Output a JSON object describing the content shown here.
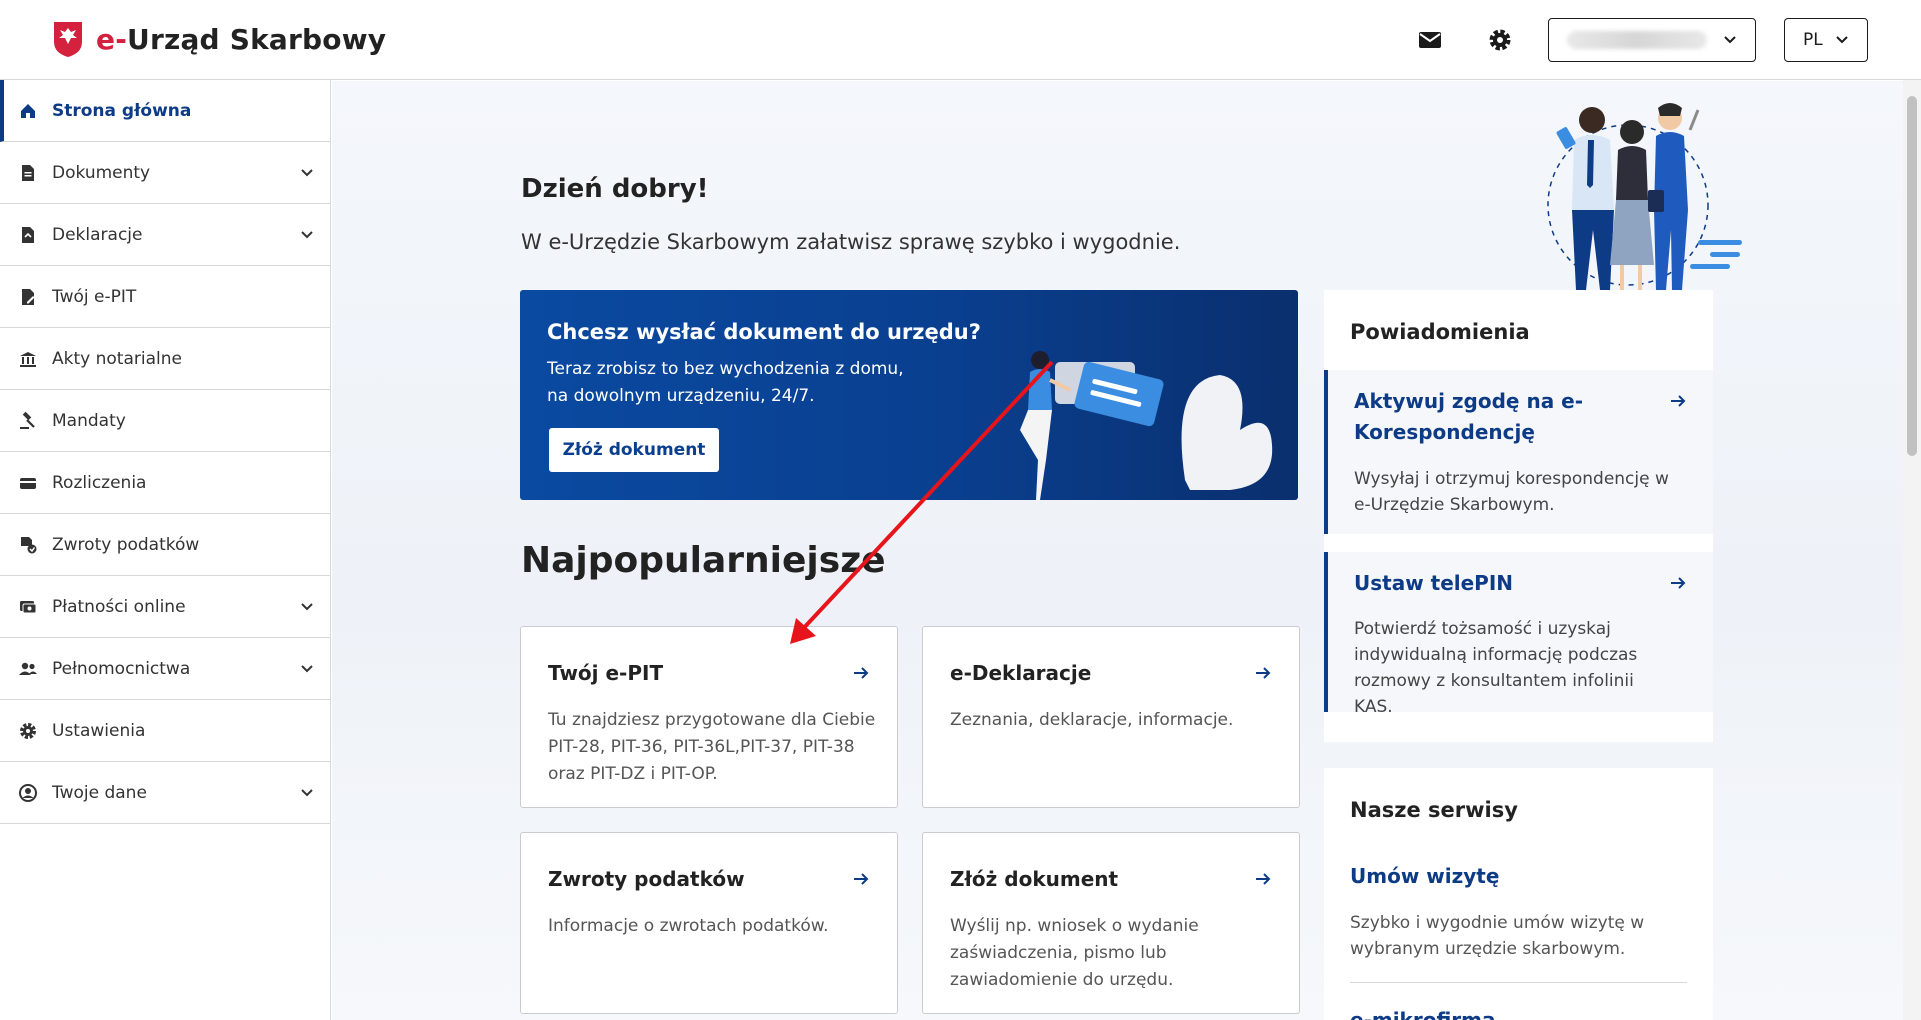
{
  "header": {
    "brand_prefix": "e-",
    "brand_rest": "Urząd Skarbowy",
    "language": "PL"
  },
  "sidebar": {
    "items": [
      {
        "label": "Strona główna",
        "icon": "home-icon",
        "expandable": false,
        "active": true
      },
      {
        "label": "Dokumenty",
        "icon": "document-icon",
        "expandable": true
      },
      {
        "label": "Deklaracje",
        "icon": "declaration-icon",
        "expandable": true
      },
      {
        "label": "Twój e-PIT",
        "icon": "epit-icon",
        "expandable": false
      },
      {
        "label": "Akty notarialne",
        "icon": "notary-icon",
        "expandable": false
      },
      {
        "label": "Mandaty",
        "icon": "gavel-icon",
        "expandable": false
      },
      {
        "label": "Rozliczenia",
        "icon": "wallet-icon",
        "expandable": false
      },
      {
        "label": "Zwroty podatków",
        "icon": "refund-icon",
        "expandable": false
      },
      {
        "label": "Płatności online",
        "icon": "payment-icon",
        "expandable": true
      },
      {
        "label": "Pełnomocnictwa",
        "icon": "people-icon",
        "expandable": true
      },
      {
        "label": "Ustawienia",
        "icon": "gear-icon",
        "expandable": false
      },
      {
        "label": "Twoje dane",
        "icon": "user-circle-icon",
        "expandable": true
      }
    ]
  },
  "greeting": {
    "title": "Dzień dobry!",
    "subtitle": "W e-Urzędzie Skarbowym załatwisz sprawę szybko i wygodnie."
  },
  "banner": {
    "title": "Chcesz wysłać dokument do urzędu?",
    "line1": "Teraz zrobisz to bez wychodzenia z domu,",
    "line2": "na dowolnym urządzeniu, 24/7.",
    "button": "Złóż dokument"
  },
  "popular": {
    "title": "Najpopularniejsze",
    "cards": [
      {
        "title": "Twój e-PIT",
        "desc": "Tu znajdziesz przygotowane dla Ciebie PIT-28, PIT-36, PIT-36L,PIT-37, PIT-38 oraz PIT-DZ i PIT-OP."
      },
      {
        "title": "e-Deklaracje",
        "desc": "Zeznania, deklaracje, informacje."
      },
      {
        "title": "Zwroty podatków",
        "desc": "Informacje o zwrotach podatków."
      },
      {
        "title": "Złóż dokument",
        "desc": "Wyślij np. wniosek o wydanie zaświadczenia, pismo lub zawiadomienie do urzędu."
      }
    ]
  },
  "notifications": {
    "title": "Powiadomienia",
    "items": [
      {
        "title": "Aktywuj zgodę na e-Korespondencję",
        "text": "Wysyłaj i otrzymuj korespondencję w e-Urzędzie Skarbowym."
      },
      {
        "title": "Ustaw telePIN",
        "text": "Potwierdź tożsamość i uzyskaj indywidualną informację podczas rozmowy z konsultantem infolinii KAS."
      }
    ]
  },
  "services": {
    "title": "Nasze serwisy",
    "link1": "Umów wizytę",
    "text1": "Szybko i wygodnie umów wizytę w wybranym urzędzie skarbowym.",
    "link2": "e-mikrofirma"
  },
  "colors": {
    "primary": "#0d3b86",
    "brand_red": "#d4213d",
    "banner": "#0a4aa1",
    "annotation_arrow": "#e8141b"
  }
}
